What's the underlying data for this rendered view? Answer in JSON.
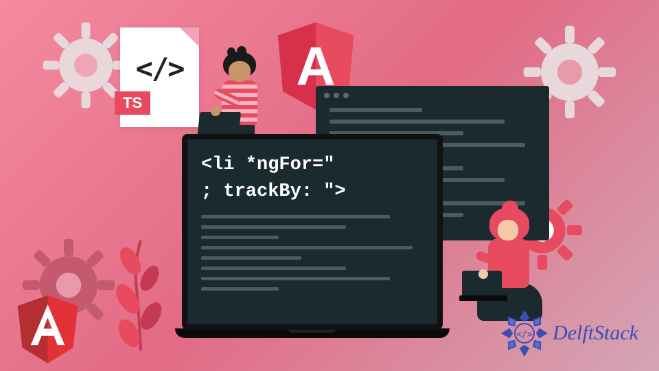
{
  "ts_badge": "TS",
  "ts_code_icon": "</>",
  "angular_letter": "A",
  "code_snippet": {
    "line1": "<li *ngFor=\"",
    "line2": "; trackBy: \">"
  },
  "brand": "DelftStack",
  "colors": {
    "accent": "#e84a5f",
    "dark": "#1a2a2f",
    "brand_blue": "#3a4db5",
    "gear_light": "#e8d7db",
    "gear_pink": "#c45a70"
  }
}
